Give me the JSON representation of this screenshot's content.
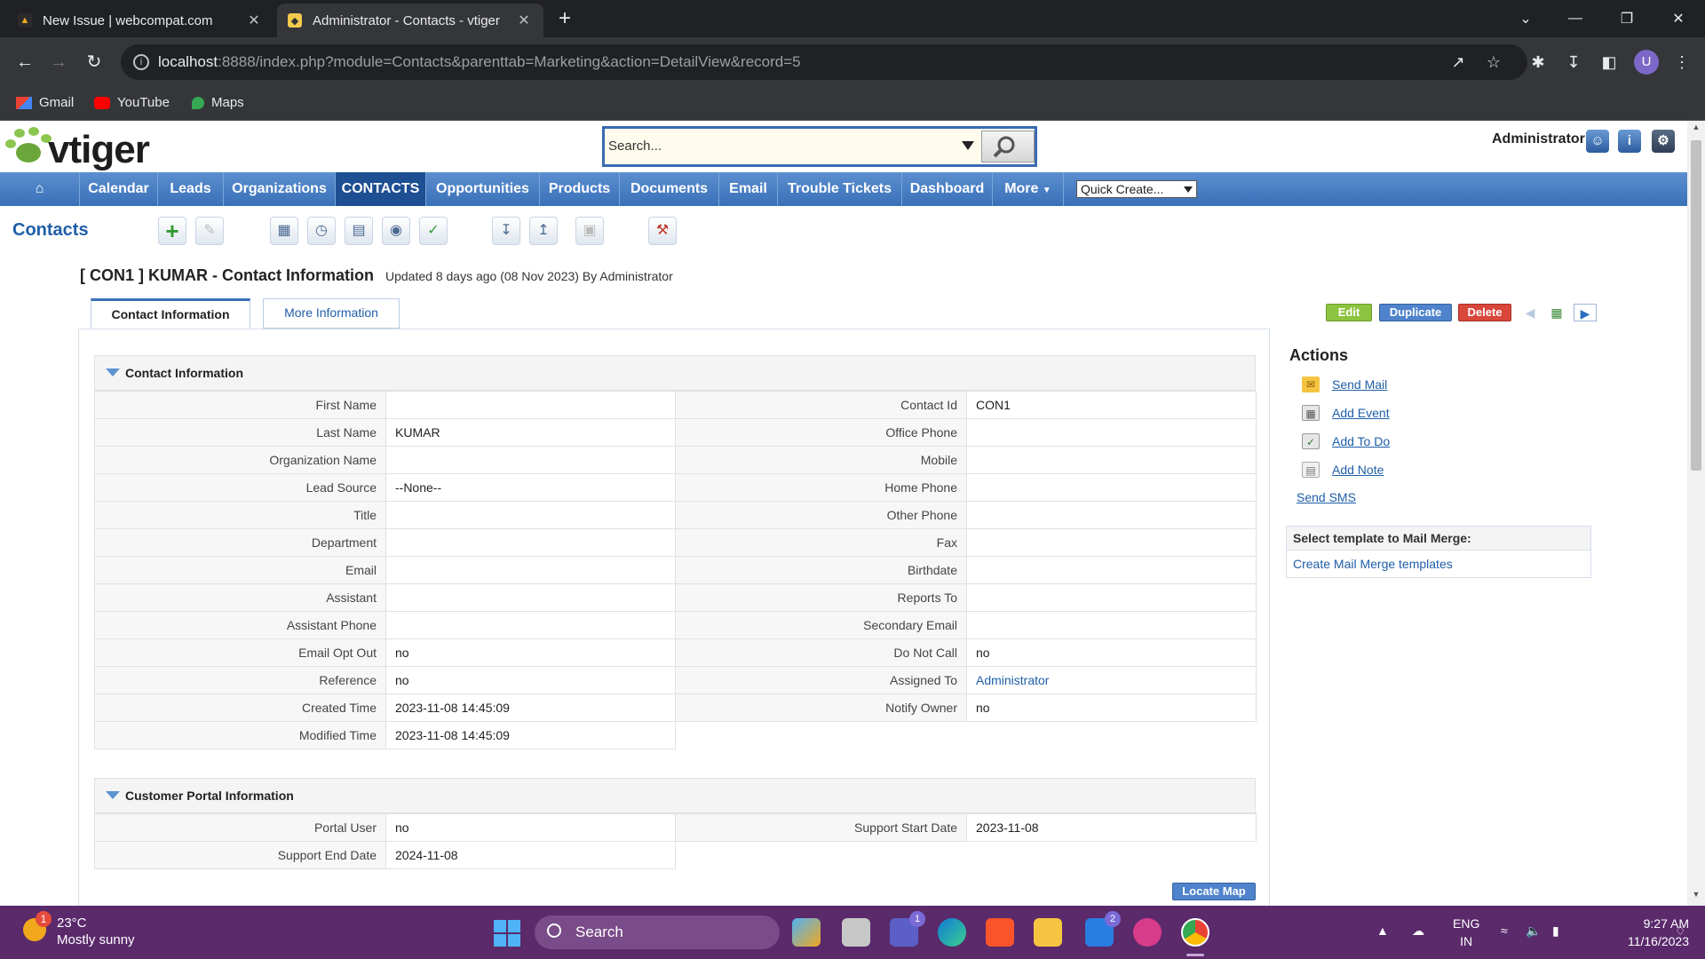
{
  "browser": {
    "tabs": [
      {
        "title": "New Issue | webcompat.com",
        "active": false
      },
      {
        "title": "Administrator - Contacts - vtiger",
        "active": true
      }
    ],
    "url_host": "localhost",
    "url_path": ":8888/index.php?module=Contacts&parenttab=Marketing&action=DetailView&record=5",
    "bookmarks": [
      "Gmail",
      "YouTube",
      "Maps"
    ],
    "profile_initial": "U"
  },
  "app": {
    "logo_text": "vtiger",
    "search_placeholder": "Search...",
    "user": "Administrator",
    "menu": [
      "Calendar",
      "Leads",
      "Organizations",
      "CONTACTS",
      "Opportunities",
      "Products",
      "Documents",
      "Email",
      "Trouble Tickets",
      "Dashboard",
      "More"
    ],
    "active_menu": "CONTACTS",
    "quick_create": "Quick Create...",
    "module_title": "Contacts"
  },
  "record": {
    "title": "[ CON1 ] KUMAR -  Contact Information",
    "updated": "Updated 8 days ago (08 Nov 2023) By Administrator",
    "tabs": [
      "Contact Information",
      "More Information"
    ],
    "buttons": {
      "edit": "Edit",
      "duplicate": "Duplicate",
      "delete": "Delete"
    }
  },
  "contact_block": {
    "header": "Contact Information",
    "rows": [
      {
        "l1": "First Name",
        "v1": "",
        "l2": "Contact Id",
        "v2": "CON1"
      },
      {
        "l1": "Last Name",
        "v1": "KUMAR",
        "l2": "Office Phone",
        "v2": ""
      },
      {
        "l1": "Organization Name",
        "v1": "",
        "l2": "Mobile",
        "v2": ""
      },
      {
        "l1": "Lead Source",
        "v1": "--None--",
        "l2": "Home Phone",
        "v2": ""
      },
      {
        "l1": "Title",
        "v1": "",
        "l2": "Other Phone",
        "v2": ""
      },
      {
        "l1": "Department",
        "v1": "",
        "l2": "Fax",
        "v2": ""
      },
      {
        "l1": "Email",
        "v1": "",
        "l2": "Birthdate",
        "v2": ""
      },
      {
        "l1": "Assistant",
        "v1": "",
        "l2": "Reports To",
        "v2": ""
      },
      {
        "l1": "Assistant Phone",
        "v1": "",
        "l2": "Secondary Email",
        "v2": ""
      },
      {
        "l1": "Email Opt Out",
        "v1": "no",
        "l2": "Do Not Call",
        "v2": "no"
      },
      {
        "l1": "Reference",
        "v1": "no",
        "l2": "Assigned To",
        "v2": "Administrator"
      },
      {
        "l1": "Created Time",
        "v1": "2023-11-08 14:45:09",
        "l2": "Notify Owner",
        "v2": "no"
      },
      {
        "l1": "Modified Time",
        "v1": "2023-11-08 14:45:09",
        "l2": "",
        "v2": ""
      }
    ]
  },
  "portal_block": {
    "header": "Customer Portal Information",
    "rows": [
      {
        "l1": "Portal User",
        "v1": "no",
        "l2": "Support Start Date",
        "v2": "2023-11-08"
      },
      {
        "l1": "Support End Date",
        "v1": "2024-11-08",
        "l2": "",
        "v2": ""
      }
    ]
  },
  "locate_map": "Locate Map",
  "actions": {
    "header": "Actions",
    "items": [
      "Send Mail",
      "Add Event",
      "Add To Do",
      "Add Note"
    ],
    "send_sms": "Send SMS",
    "mail_merge_header": "Select template to Mail Merge:",
    "mail_merge_link": "Create Mail Merge templates"
  },
  "taskbar": {
    "weather_temp": "23°C",
    "weather_desc": "Mostly sunny",
    "weather_badge": "1",
    "search": "Search",
    "lang1": "ENG",
    "lang2": "IN",
    "time": "9:27 AM",
    "date": "11/16/2023",
    "badge_teams": "1",
    "badge_mail": "2"
  }
}
